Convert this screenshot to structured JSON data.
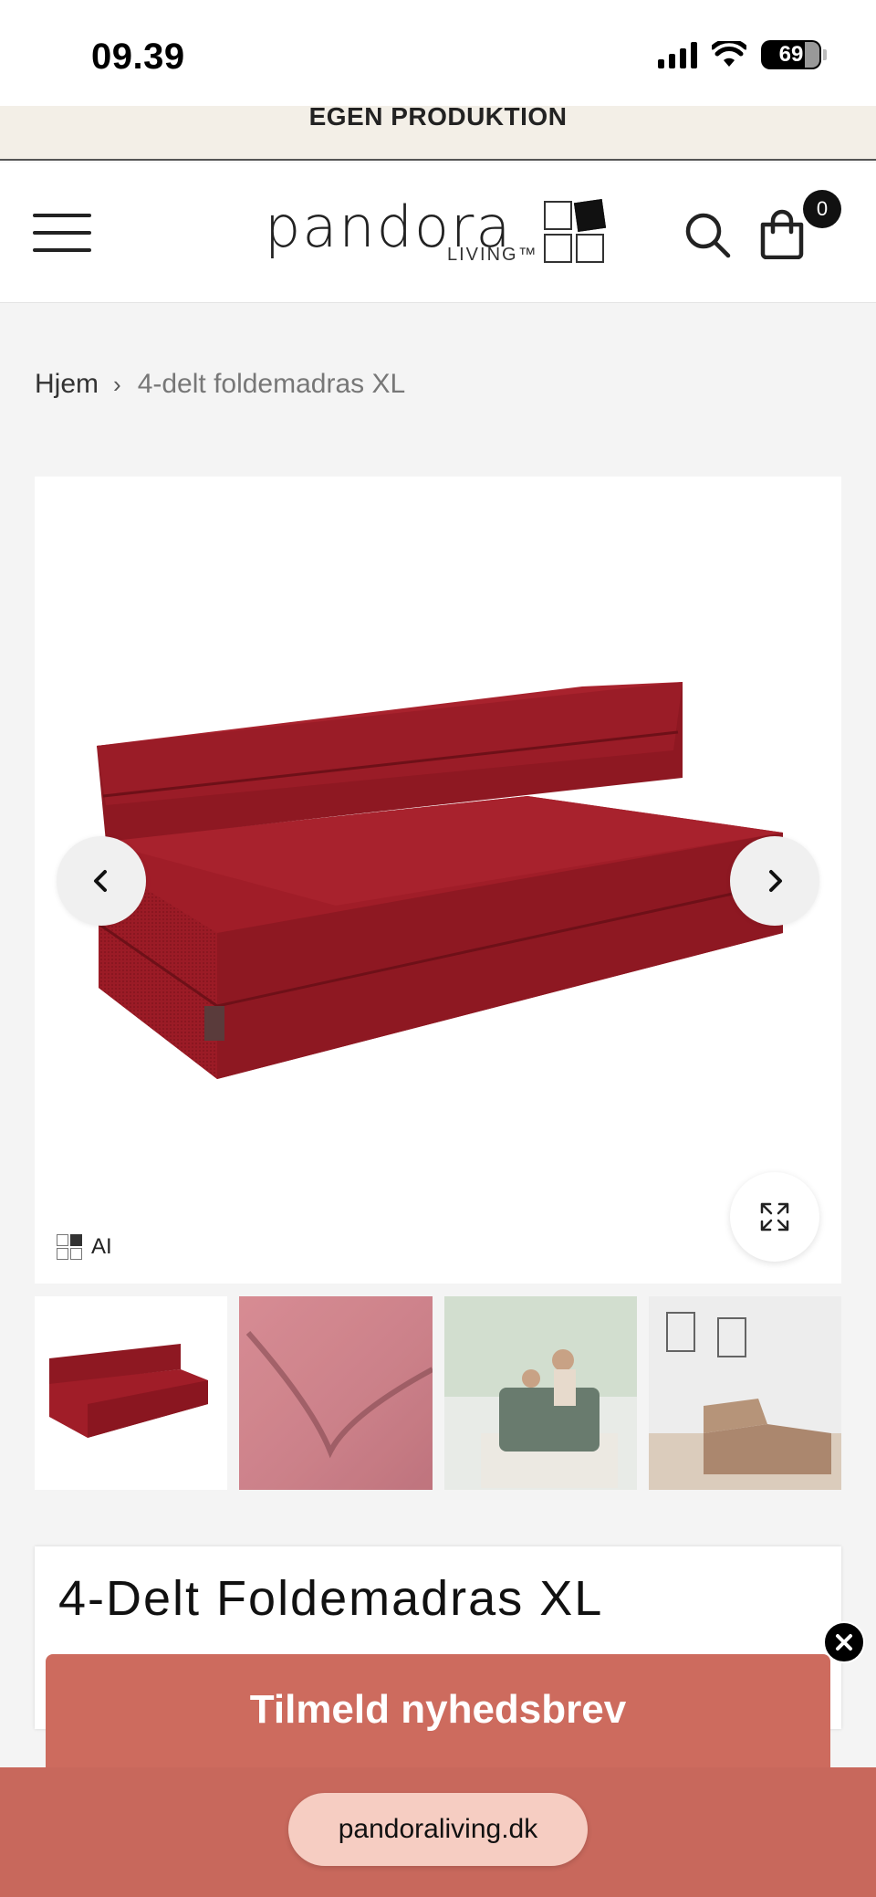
{
  "status_bar": {
    "time": "09.39",
    "battery": "69"
  },
  "announcement": {
    "text": "EGEN PRODUKTION"
  },
  "header": {
    "logo_word": "pandora",
    "logo_sub": "LIVING™",
    "cart_count": "0"
  },
  "breadcrumb": {
    "home": "Hjem",
    "separator": "›",
    "current": "4-delt foldemadras XL"
  },
  "gallery": {
    "ai_label": "AI",
    "product_color": "#9b1b26",
    "thumbnails": [
      "red-mattress",
      "red-fabric-closeup",
      "family-living-room",
      "brown-mattress-room"
    ]
  },
  "product": {
    "title": "4-Delt Foldemadras XL"
  },
  "newsletter": {
    "label": "Tilmeld nyhedsbrev",
    "color": "#cd6b5e"
  },
  "browser": {
    "url": "pandoraliving.dk"
  }
}
